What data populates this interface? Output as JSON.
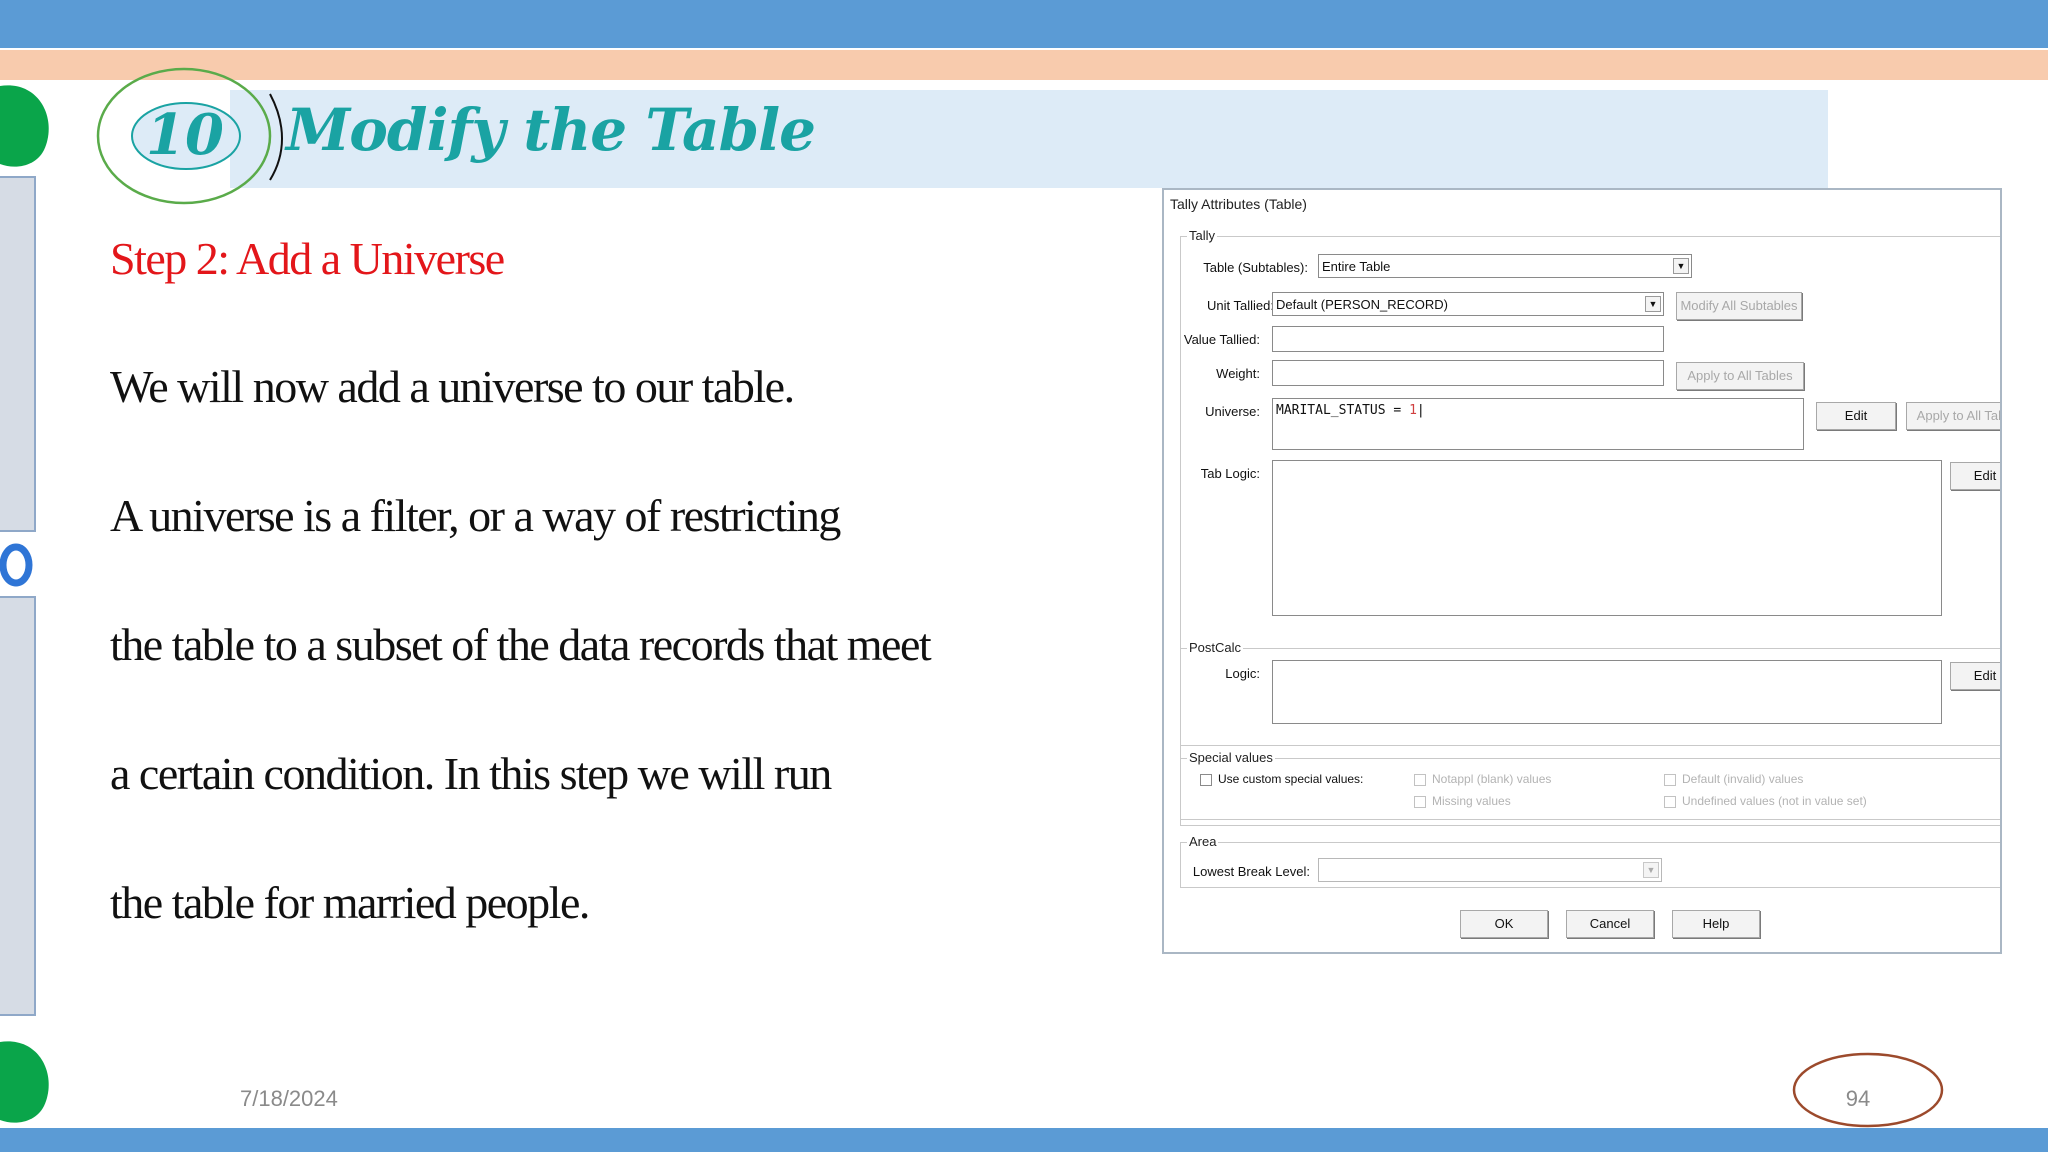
{
  "slide": {
    "number": "10",
    "title": "Modify the Table",
    "step_heading": "Step 2: Add a Universe",
    "body_lines": [
      "We will now add a universe to our table.",
      "A universe is a filter, or a way of restricting",
      "the table to a subset of the data records that meet",
      "a certain condition. In this step we will run",
      "the table for married people."
    ],
    "footer_date": "7/18/2024",
    "page_number": "94",
    "colors": {
      "title": "#1aa3a3",
      "step_heading": "#e3161a",
      "top_band": "#5b9bd5",
      "peach_band": "#f8cbad",
      "title_band": "#ddebf7"
    }
  },
  "dialog": {
    "title": "Tally Attributes (Table)",
    "tally": {
      "group_label": "Tally",
      "table_subtables_label": "Table (Subtables):",
      "table_subtables_value": "Entire Table",
      "unit_tallied_label": "Unit Tallied:",
      "unit_tallied_value": "Default (PERSON_RECORD)",
      "modify_all_subtables_label": "Modify All Subtables",
      "value_tallied_label": "Value Tallied:",
      "value_tallied_value": "",
      "weight_label": "Weight:",
      "weight_value": "",
      "apply_to_all_tables_label": "Apply to All Tables",
      "universe_label": "Universe:",
      "universe_value_name": "MARITAL_STATUS",
      "universe_value_op": "=",
      "universe_value_num": "1",
      "universe_edit_label": "Edit",
      "universe_apply_label": "Apply to All Tab",
      "tab_logic_label": "Tab Logic:",
      "tab_logic_edit_label": "Edit"
    },
    "postcalc": {
      "group_label": "PostCalc",
      "logic_label": "Logic:",
      "edit_label": "Edit"
    },
    "special_values": {
      "group_label": "Special values",
      "use_custom_label": "Use custom special values:",
      "notappl_label": "Notappl (blank) values",
      "missing_label": "Missing values",
      "default_label": "Default (invalid) values",
      "undefined_label": "Undefined values (not in value set)"
    },
    "area": {
      "group_label": "Area",
      "lowest_break_label": "Lowest Break Level:",
      "lowest_break_value": ""
    },
    "buttons": {
      "ok": "OK",
      "cancel": "Cancel",
      "help": "Help"
    },
    "icons": {
      "dropdown": "▼"
    }
  }
}
